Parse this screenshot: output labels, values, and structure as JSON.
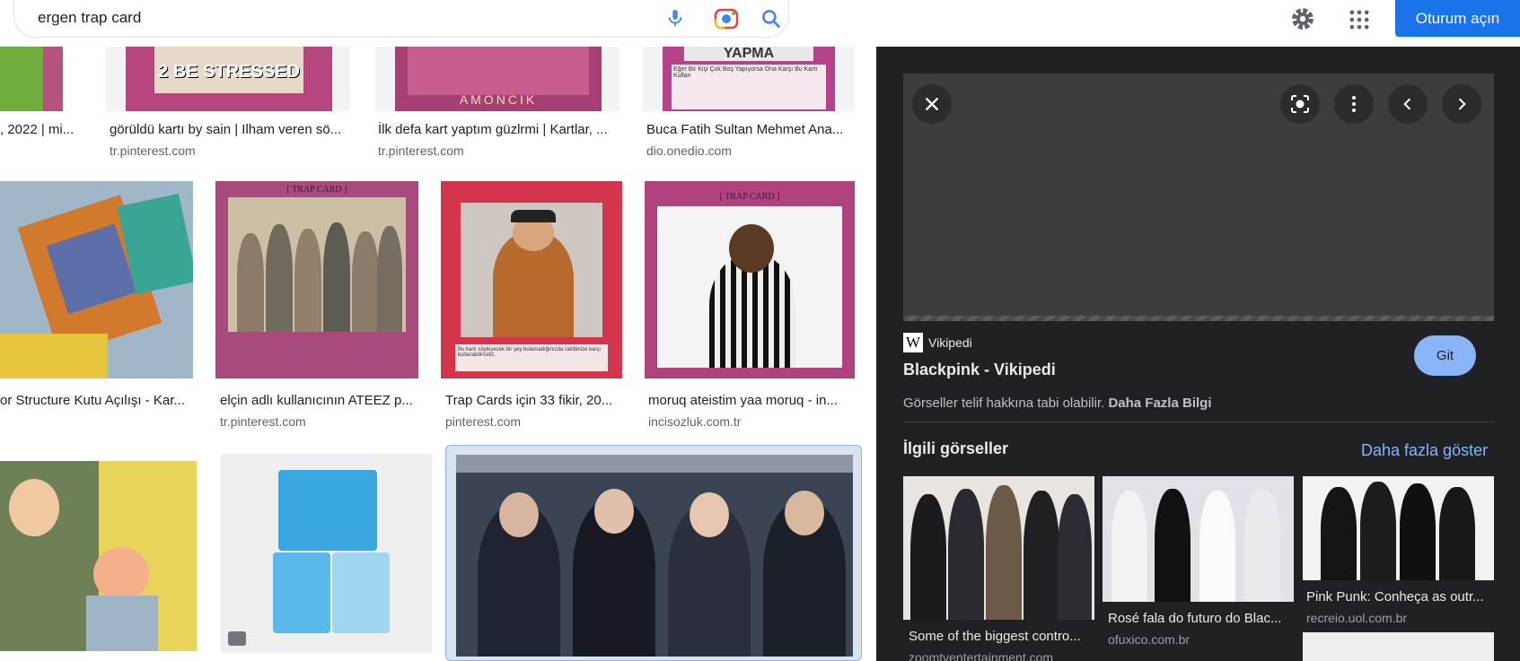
{
  "search": {
    "query": "ergen trap card"
  },
  "header": {
    "signin_label": "Oturum açın"
  },
  "results": [
    {
      "title": ", 2022 | mi...",
      "source": ""
    },
    {
      "title": "görüldü kartı by sain | Ilham veren sö...",
      "source": "tr.pinterest.com"
    },
    {
      "title": "İlk defa kart yaptım güzlrmi | Kartlar, ...",
      "source": "tr.pinterest.com"
    },
    {
      "title": "Buca Fatih Sultan Mehmet Ana...",
      "source": "dio.onedio.com"
    },
    {
      "title": "or Structure Kutu Açılışı - Kar...",
      "source": ""
    },
    {
      "title": "elçin adlı kullanıcının ATEEZ p...",
      "source": "tr.pinterest.com"
    },
    {
      "title": "Trap Cards için 33 fikir, 20...",
      "source": "pinterest.com"
    },
    {
      "title": "moruq ateistim yaa moruq - in...",
      "source": "incisozluk.com.tr"
    }
  ],
  "card_text": {
    "stressed": "2 BE STRESSED",
    "yapma": "YAPMA",
    "amoncik": "AMONCIK",
    "trap_card": "[ TRAP CARD ]",
    "yapma_desc": "Eğer Bir Kişi Çok Boş Yapıyorsa Ona Karşı Bu Kartı Kullan",
    "card_desc": "Bu kartı söyleyecek bir şey bulamadığınızda rakibinize karşı kullanabilirsiniz."
  },
  "panel": {
    "source_name": "Vikipedi",
    "title": "Blackpink - Vikipedi",
    "go_label": "Git",
    "copyright": "Görseller telif hakkına tabi olabilir.",
    "more_info": "Daha Fazla Bilgi",
    "related_heading": "İlgili görseller",
    "more_link": "Daha fazla göster",
    "related": [
      {
        "title": "Some of the biggest contro...",
        "source": "zoomtventertainment.com"
      },
      {
        "title": "Rosé fala do futuro do Blac...",
        "source": "ofuxico.com.br"
      },
      {
        "title": "Pink Punk: Conheça as outr...",
        "source": "recreio.uol.com.br"
      }
    ]
  },
  "icons": [
    "mic-icon",
    "lens-icon",
    "search-icon",
    "gear-icon",
    "apps-icon",
    "close-icon",
    "visual-search-icon",
    "more-vert-icon",
    "chevron-left-icon",
    "chevron-right-icon",
    "tag-icon"
  ],
  "colors": {
    "accent": "#1a73e8",
    "panel_bg": "#202124",
    "link": "#8ab4f8",
    "trap_card": "#b3447e"
  }
}
